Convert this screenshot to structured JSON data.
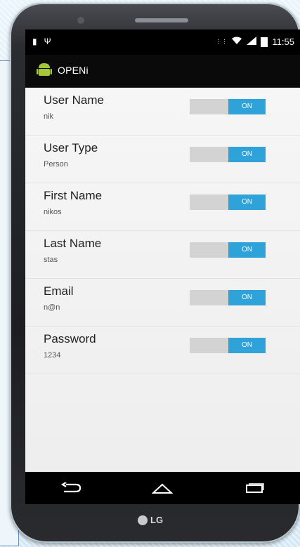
{
  "status_bar": {
    "time": "11:55",
    "icons": [
      "sd-card-icon",
      "usb-icon",
      "data-icon",
      "wifi-icon",
      "signal-icon",
      "battery-icon"
    ]
  },
  "action_bar": {
    "title": "OPENi"
  },
  "settings": [
    {
      "label": "User Name",
      "value": "nik",
      "toggle": "ON"
    },
    {
      "label": "User Type",
      "value": "Person",
      "toggle": "ON"
    },
    {
      "label": "First Name",
      "value": "nikos",
      "toggle": "ON"
    },
    {
      "label": "Last Name",
      "value": "stas",
      "toggle": "ON"
    },
    {
      "label": "Email",
      "value": "n@n",
      "toggle": "ON"
    },
    {
      "label": "Password",
      "value": "1234",
      "toggle": "ON"
    }
  ],
  "nav": {
    "back": "back-icon",
    "home": "home-icon",
    "recents": "recents-icon"
  },
  "brand": {
    "name": "LG"
  },
  "colors": {
    "accent": "#2ea2d9",
    "bar": "#000000",
    "background": "#eeeeee"
  }
}
